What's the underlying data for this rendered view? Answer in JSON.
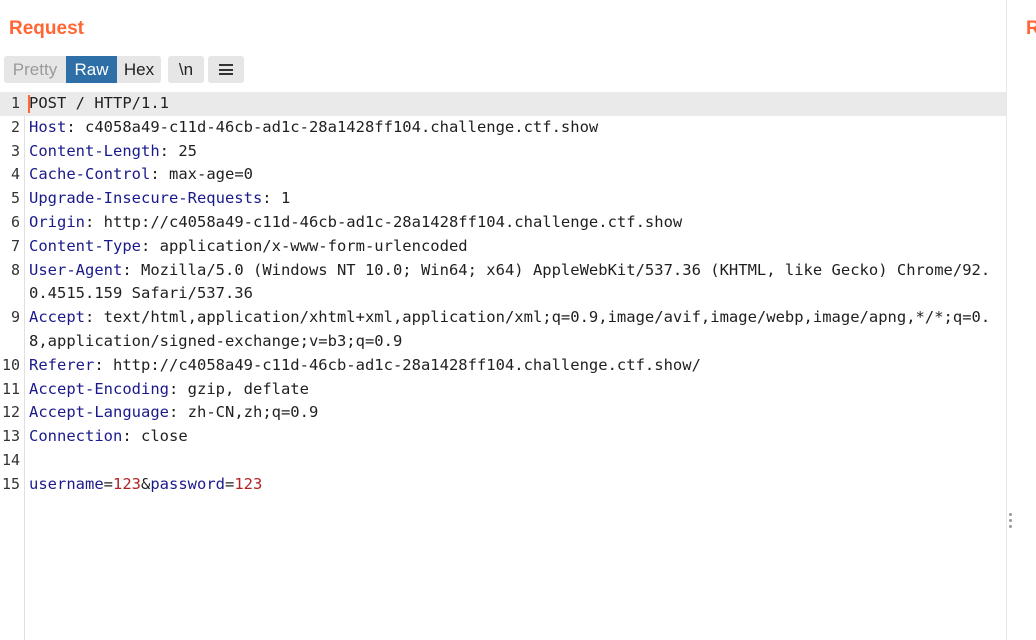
{
  "panel": {
    "title": "Request",
    "right_title": "R"
  },
  "toolbar": {
    "pretty": "Pretty",
    "raw": "Raw",
    "hex": "Hex",
    "newline": "\\n",
    "menu_icon": "hamburger-menu-icon"
  },
  "colors": {
    "accent": "#ff6633",
    "selected_tab": "#2e6fa7",
    "header_name": "#1a1a8c",
    "param_value": "#b22222"
  },
  "lines": [
    {
      "num": "1",
      "text": "POST / HTTP/1.1"
    },
    {
      "num": "2",
      "name": "Host",
      "value": " c4058a49-c11d-46cb-ad1c-28a1428ff104.challenge.ctf.show"
    },
    {
      "num": "3",
      "name": "Content-Length",
      "value": " 25"
    },
    {
      "num": "4",
      "name": "Cache-Control",
      "value": " max-age=0"
    },
    {
      "num": "5",
      "name": "Upgrade-Insecure-Requests",
      "value": " 1"
    },
    {
      "num": "6",
      "name": "Origin",
      "value": " http://c4058a49-c11d-46cb-ad1c-28a1428ff104.challenge.ctf.show"
    },
    {
      "num": "7",
      "name": "Content-Type",
      "value": " application/x-www-form-urlencoded"
    },
    {
      "num": "8",
      "name": "User-Agent",
      "value": " Mozilla/5.0 (Windows NT 10.0; Win64; x64) AppleWebKit/537.36 (KHTML, like Gecko) Chrome/92.0.4515.159 Safari/537.36"
    },
    {
      "num": "9",
      "name": "Accept",
      "value": " text/html,application/xhtml+xml,application/xml;q=0.9,image/avif,image/webp,image/apng,*/*;q=0.8,application/signed-exchange;v=b3;q=0.9"
    },
    {
      "num": "10",
      "name": "Referer",
      "value": " http://c4058a49-c11d-46cb-ad1c-28a1428ff104.challenge.ctf.show/"
    },
    {
      "num": "11",
      "name": "Accept-Encoding",
      "value": " gzip, deflate"
    },
    {
      "num": "12",
      "name": "Accept-Language",
      "value": " zh-CN,zh;q=0.9"
    },
    {
      "num": "13",
      "name": "Connection",
      "value": " close"
    },
    {
      "num": "14",
      "text": ""
    },
    {
      "num": "15",
      "body": [
        {
          "k": "username",
          "v": "123"
        },
        {
          "k": "password",
          "v": "123"
        }
      ]
    }
  ]
}
